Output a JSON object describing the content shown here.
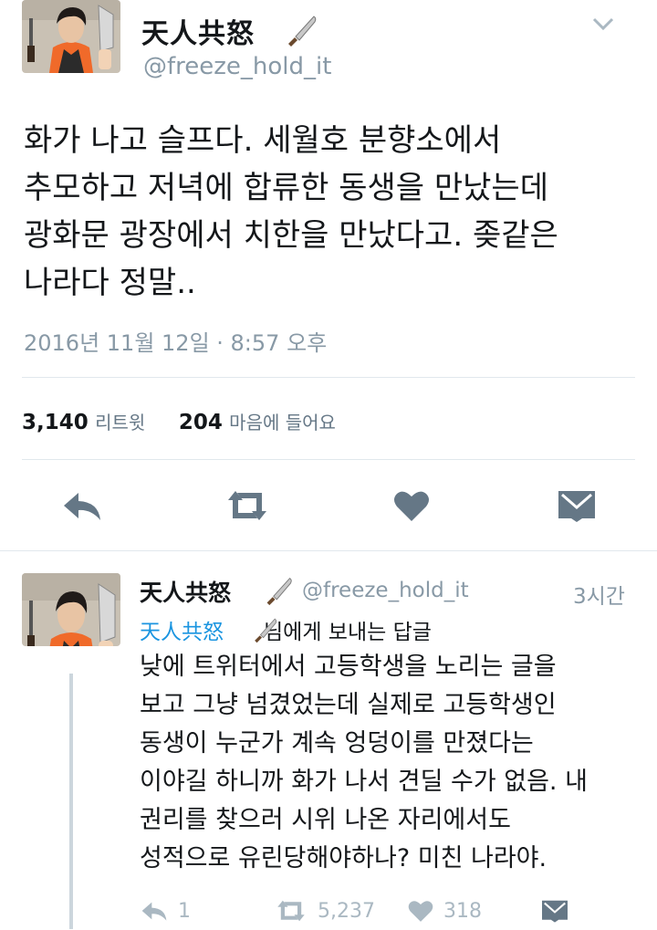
{
  "main_tweet": {
    "display_name": "天人共怒",
    "handle": "@freeze_hold_it",
    "text": "화가 나고 슬프다. 세월호 분향소에서\n추모하고 저녁에 합류한 동생을 만났는데\n광화문 광장에서 치한을 만났다고. 좆같은\n나라다 정말..",
    "timestamp": "2016년 11월 12일 · 8:57 오후",
    "retweet_count": "3,140",
    "retweet_label": "리트윗",
    "like_count": "204",
    "like_label": "마음에 들어요"
  },
  "reply_tweet": {
    "display_name": "天人共怒",
    "handle": "@freeze_hold_it",
    "time": "3시간",
    "reply_to_name": "天人共怒",
    "reply_to_suffix": "님에게 보내는 답글",
    "text": "낮에 트위터에서 고등학생을 노리는 글을\n보고 그냥 넘겼었는데 실제로 고등학생인\n동생이 누군가 계속 엉덩이를 만졌다는\n이야길 하니까 화가 나서 견딜 수가 없음. 내\n권리를 찾으러 시위 나온 자리에서도\n성적으로 유린당해야하나? 미친 나라야.",
    "reply_count": "1",
    "retweet_count": "5,237",
    "like_count": "318"
  },
  "icons": {
    "knife": "knife-icon",
    "chevron": "chevron-down-icon",
    "reply": "reply-icon",
    "retweet": "retweet-icon",
    "like": "heart-icon",
    "dm": "envelope-icon"
  },
  "colors": {
    "text": "#14171a",
    "muted": "#8899a6",
    "action_icon": "#657786",
    "reply_action": "#aab8c2",
    "link_blue": "#1b95e0",
    "divider": "#e1e8ed",
    "apron_orange": "#f06a2a"
  }
}
